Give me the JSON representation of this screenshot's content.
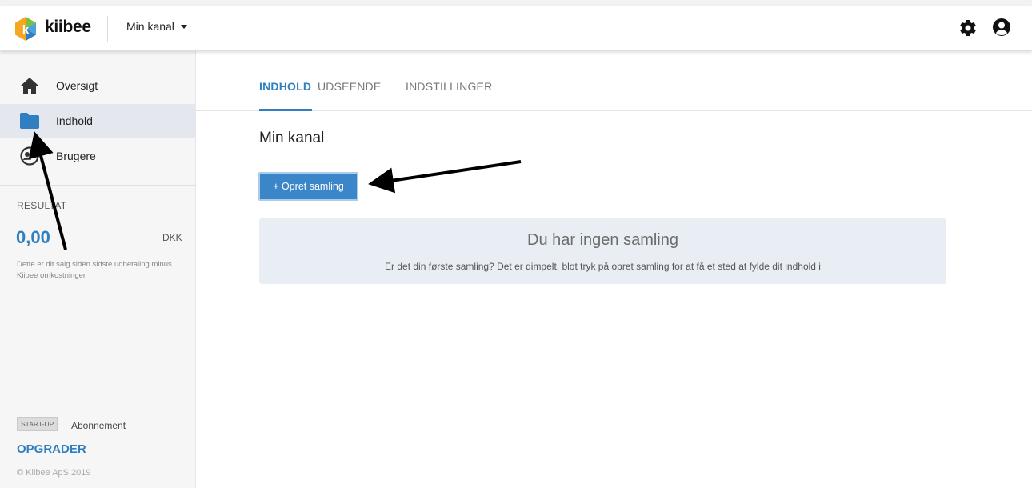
{
  "header": {
    "brand": "kiibee",
    "channel_select": "Min kanal",
    "icons": {
      "logo": "kiibee-logo-icon",
      "settings": "gear-icon",
      "account": "user-circle-icon"
    }
  },
  "sidebar": {
    "items": [
      {
        "label": "Oversigt",
        "icon": "home-icon",
        "active": false
      },
      {
        "label": "Indhold",
        "icon": "folder-icon",
        "active": true
      },
      {
        "label": "Brugere",
        "icon": "users-icon",
        "active": false
      }
    ],
    "result": {
      "label": "RESULTAT",
      "value": "0,00",
      "currency": "DKK",
      "note": "Dette er dit salg siden sidste udbetaling minus Kiibee omkostninger"
    },
    "plan": {
      "badge": "START-UP",
      "label": "Abonnement",
      "upgrade": "OPGRADER"
    },
    "copyright": "© Kiibee ApS 2019"
  },
  "main": {
    "tabs": [
      {
        "label": "INDHOLD",
        "active": true
      },
      {
        "label": "UDSEENDE",
        "active": false
      },
      {
        "label": "INDSTILLINGER",
        "active": false
      }
    ],
    "title": "Min kanal",
    "create_button": "+ Opret samling",
    "empty_state": {
      "title": "Du har ingen samling",
      "subtitle": "Er det din første samling? Det er dimpelt, blot tryk på opret samling for at få et sted at fylde dit indhold i"
    }
  },
  "colors": {
    "accent": "#2f7fc1",
    "button": "#3a86c8",
    "active_nav_bg": "#e4e7ee",
    "empty_panel_bg": "#e8eef3"
  }
}
